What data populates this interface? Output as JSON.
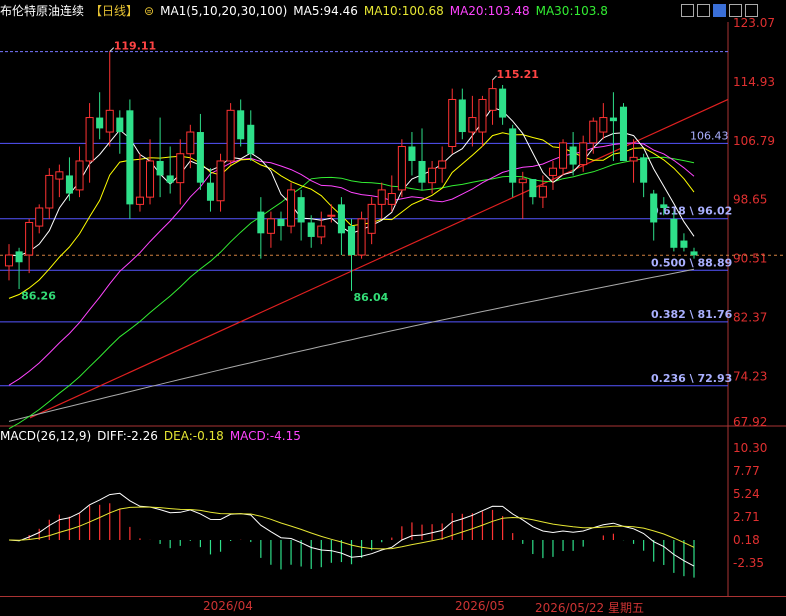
{
  "header": {
    "title": "布伦特原油连续",
    "period": "【日线】",
    "ma_label": "MA1(5,10,20,30,100)",
    "ma5": "MA5:94.46",
    "ma10": "MA10:100.68",
    "ma20": "MA20:103.48",
    "ma30": "MA30:103.8"
  },
  "macd_header": {
    "label": "MACD(26,12,9)",
    "diff": "DIFF:-2.26",
    "dea": "DEA:-0.18",
    "macd": "MACD:-4.15"
  },
  "x_axis": {
    "labels": [
      "2026/04",
      "2026/05",
      "2026/05/22 星期五"
    ]
  },
  "colors": {
    "up": "#ff3333",
    "down": "#2ee08a",
    "ma5": "#ffffff",
    "ma10": "#ffff00",
    "ma20": "#ff44ff",
    "ma30": "#33ee33",
    "ma100": "#aaaaaa",
    "fib": "#5555ff"
  },
  "chart_data": [
    {
      "type": "candlestick",
      "y_ticks": [
        123.07,
        114.93,
        106.79,
        98.65,
        90.51,
        82.37,
        74.23,
        67.92
      ],
      "ylim": [
        67.92,
        123.07
      ],
      "annotations": [
        {
          "label": "119.11",
          "value": 119.11
        },
        {
          "label": "115.21",
          "value": 115.21
        },
        {
          "label": "86.26",
          "value": 86.26
        },
        {
          "label": "86.04",
          "value": 86.04
        }
      ],
      "fib_levels": [
        {
          "label": "0.618 \\ 96.02",
          "value": 96.02
        },
        {
          "label": "0.500 \\ 88.89",
          "value": 88.89
        },
        {
          "label": "0.382 \\ 81.76",
          "value": 81.76
        },
        {
          "label": "0.236 \\ 72.93",
          "value": 72.93
        }
      ],
      "extra_levels": [
        119.11,
        106.43
      ],
      "extra_labels": [
        {
          "label": "106.43",
          "value": 106.43
        }
      ],
      "last_price": 90.96,
      "candles": [
        [
          89.5,
          92.5,
          87.5,
          91.0
        ],
        [
          91.5,
          92.0,
          86.3,
          90.0
        ],
        [
          91.0,
          96.0,
          88.5,
          95.5
        ],
        [
          95.0,
          98.0,
          94.0,
          97.5
        ],
        [
          97.5,
          103.0,
          96.0,
          102.0
        ],
        [
          101.5,
          103.5,
          99.0,
          102.5
        ],
        [
          102.0,
          104.5,
          98.5,
          99.5
        ],
        [
          100.0,
          106.0,
          99.0,
          104.0
        ],
        [
          104.0,
          112.0,
          101.0,
          110.0
        ],
        [
          110.0,
          113.5,
          107.0,
          108.5
        ],
        [
          108.0,
          119.11,
          106.0,
          111.0
        ],
        [
          110.0,
          111.0,
          105.0,
          108.0
        ],
        [
          111.0,
          112.5,
          96.0,
          98.0
        ],
        [
          98.0,
          105.0,
          97.0,
          99.0
        ],
        [
          99.0,
          107.0,
          98.0,
          104.0
        ],
        [
          104.0,
          110.0,
          99.0,
          102.0
        ],
        [
          102.0,
          106.0,
          99.5,
          101.0
        ],
        [
          101.0,
          107.0,
          98.0,
          105.0
        ],
        [
          105.0,
          109.0,
          103.0,
          108.0
        ],
        [
          108.0,
          110.5,
          100.0,
          101.0
        ],
        [
          101.0,
          103.0,
          97.0,
          98.5
        ],
        [
          98.5,
          105.0,
          97.0,
          104.0
        ],
        [
          104.0,
          112.0,
          103.5,
          111.0
        ],
        [
          111.0,
          112.5,
          106.0,
          107.0
        ],
        [
          109.0,
          111.0,
          104.0,
          105.0
        ],
        [
          97.0,
          99.0,
          90.5,
          94.0
        ],
        [
          94.0,
          97.0,
          92.0,
          96.0
        ],
        [
          96.0,
          97.0,
          93.0,
          95.0
        ],
        [
          95.0,
          101.0,
          94.0,
          100.0
        ],
        [
          99.0,
          100.0,
          93.0,
          95.5
        ],
        [
          95.5,
          96.5,
          92.0,
          93.5
        ],
        [
          93.5,
          97.0,
          92.5,
          95.0
        ],
        [
          96.5,
          98.0,
          95.5,
          96.5
        ],
        [
          98.0,
          99.0,
          91.0,
          94.0
        ],
        [
          95.0,
          96.0,
          86.04,
          91.0
        ],
        [
          91.0,
          97.0,
          90.5,
          96.0
        ],
        [
          94.0,
          99.0,
          92.5,
          98.0
        ],
        [
          98.0,
          101.0,
          96.0,
          100.0
        ],
        [
          98.0,
          102.0,
          97.0,
          99.5
        ],
        [
          100.0,
          107.0,
          99.0,
          106.0
        ],
        [
          106.0,
          108.0,
          102.0,
          104.0
        ],
        [
          104.0,
          108.5,
          100.0,
          101.0
        ],
        [
          101.0,
          104.0,
          99.5,
          103.0
        ],
        [
          103.0,
          106.0,
          101.0,
          104.0
        ],
        [
          106.0,
          114.0,
          105.0,
          112.5
        ],
        [
          112.5,
          114.0,
          107.0,
          108.0
        ],
        [
          108.0,
          113.0,
          106.0,
          110.0
        ],
        [
          108.0,
          113.0,
          106.0,
          112.5
        ],
        [
          111.0,
          115.21,
          109.0,
          114.0
        ],
        [
          114.0,
          114.5,
          109.0,
          110.0
        ],
        [
          108.5,
          109.0,
          99.0,
          101.0
        ],
        [
          101.0,
          102.5,
          96.0,
          101.5
        ],
        [
          101.5,
          101.5,
          98.0,
          99.0
        ],
        [
          99.0,
          102.0,
          97.5,
          100.5
        ],
        [
          102.0,
          104.0,
          100.0,
          103.0
        ],
        [
          103.0,
          107.0,
          102.0,
          106.5
        ],
        [
          106.0,
          108.0,
          102.0,
          103.5
        ],
        [
          103.5,
          107.5,
          102.5,
          106.5
        ],
        [
          106.5,
          110.0,
          105.0,
          109.5
        ],
        [
          108.0,
          112.0,
          107.0,
          110.0
        ],
        [
          110.0,
          113.5,
          104.0,
          109.5
        ],
        [
          111.5,
          112.0,
          104.0,
          104.0
        ],
        [
          104.0,
          107.0,
          101.0,
          104.5
        ],
        [
          104.5,
          105.0,
          99.0,
          101.0
        ],
        [
          99.5,
          100.0,
          93.0,
          95.5
        ],
        [
          98.0,
          99.0,
          96.5,
          97.5
        ],
        [
          96.0,
          97.0,
          91.5,
          92.0
        ],
        [
          93.0,
          94.0,
          91.5,
          92.0
        ],
        [
          91.5,
          92.0,
          90.5,
          90.96
        ]
      ]
    },
    {
      "type": "macd",
      "y_ticks": [
        10.3,
        7.77,
        5.24,
        2.71,
        0.18,
        -2.35
      ],
      "ylim": [
        -4.5,
        11.0
      ],
      "diff_label": "DIFF:-2.26",
      "dea_label": "DEA:-0.18",
      "macd_label": "MACD:-4.15"
    }
  ]
}
